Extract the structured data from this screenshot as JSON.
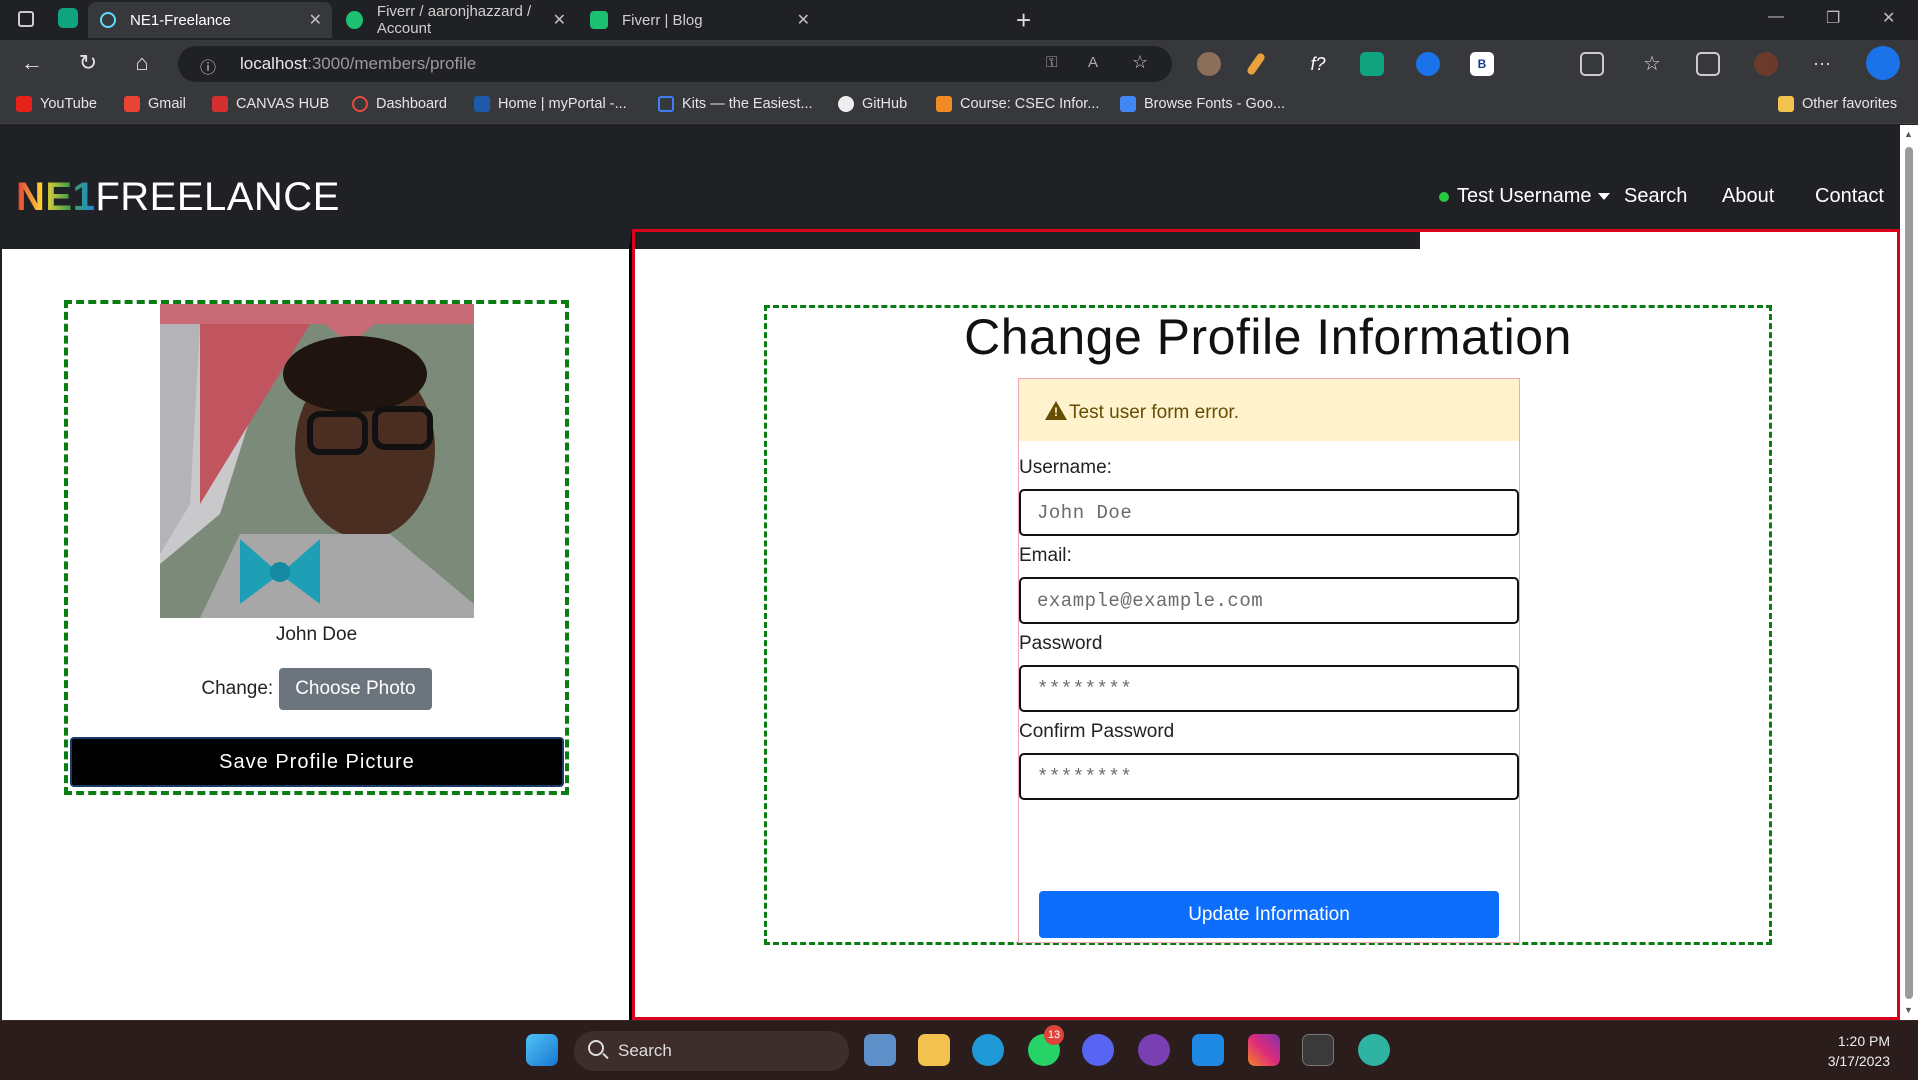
{
  "browser": {
    "tabs": [
      {
        "title": "NE1-Freelance",
        "active": true
      },
      {
        "title": "Fiverr / aaronjhazzard / Account",
        "active": false
      },
      {
        "title": "Fiverr | Blog",
        "active": false
      }
    ],
    "url_host": "localhost",
    "url_path": ":3000/members/profile",
    "bookmarks": [
      "YouTube",
      "Gmail",
      "CANVAS HUB",
      "Dashboard",
      "Home | myPortal -...",
      "Kits — the Easiest...",
      "GitHub",
      "Course: CSEC Infor...",
      "Browse Fonts - Goo...",
      "Other favorites"
    ],
    "extension_f": "f?",
    "extension_b": "B"
  },
  "navbar": {
    "logo_prefix": "NE1",
    "logo_suffix": "FREELANCE",
    "user": "Test Username",
    "links": [
      "Search",
      "About",
      "Contact"
    ]
  },
  "profile_picture": {
    "name": "John Doe",
    "change_label": "Change:",
    "choose_button": "Choose Photo",
    "save_button": "Save Profile Picture"
  },
  "form": {
    "title": "Change Profile Information",
    "alert": "Test user form error.",
    "fields": [
      {
        "label": "Username:",
        "placeholder": "John Doe"
      },
      {
        "label": "Email:",
        "placeholder": "example@example.com"
      },
      {
        "label": "Password",
        "placeholder": "********"
      },
      {
        "label": "Confirm Password",
        "placeholder": "********"
      }
    ],
    "submit": "Update Information"
  },
  "taskbar": {
    "search": "Search",
    "whatsapp_badge": "13",
    "time": "1:20 PM",
    "date": "3/17/2023"
  },
  "colors": {
    "accent_blue": "#0d6efd",
    "frame_red": "#d8001b",
    "dashed_green": "#0a7d12",
    "alert_bg": "#fff3cd"
  }
}
